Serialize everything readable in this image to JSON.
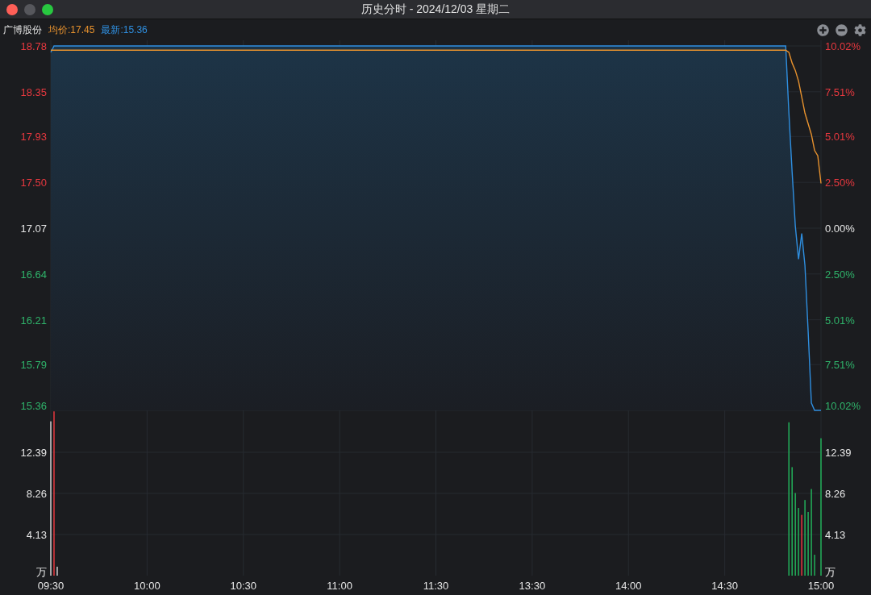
{
  "window": {
    "title": "历史分时 - 2024/12/03 星期二"
  },
  "legend": {
    "name": "广博股份",
    "average": "均价:17.45",
    "latest": "最新:15.36"
  },
  "price_axis": {
    "left": [
      {
        "color": "#e8383f"
      },
      {
        "color": "#e8383f"
      },
      {
        "color": "#e8383f"
      },
      {
        "color": "#e8383f"
      },
      {
        "color": "#e6e6e6"
      },
      {
        "color": "#2fb36a"
      },
      {
        "color": "#2fb36a"
      },
      {
        "color": "#2fb36a"
      },
      {
        "color": "#2fb36a"
      }
    ],
    "right": [
      {
        "label": "10.02%",
        "color": "#e8383f"
      },
      {
        "label": "7.51%",
        "color": "#e8383f"
      },
      {
        "label": "5.01%",
        "color": "#e8383f"
      },
      {
        "label": "2.50%",
        "color": "#e8383f"
      },
      {
        "label": "0.00%",
        "color": "#e6e6e6"
      },
      {
        "label": "2.50%",
        "color": "#2fb36a"
      },
      {
        "label": "5.01%",
        "color": "#2fb36a"
      },
      {
        "label": "7.51%",
        "color": "#2fb36a"
      },
      {
        "label": "10.02%",
        "color": "#2fb36a"
      }
    ]
  },
  "price_chart": {
    "chart_data": {
      "type": "line",
      "grid": true,
      "ylim": [
        15.36,
        18.78
      ],
      "yticks": [
        18.78,
        18.35,
        17.93,
        {
          "value": 17.5,
          "label": "17.50"
        },
        17.07,
        16.64,
        16.21,
        15.79,
        15.36
      ],
      "categories": [
        null,
        null,
        null,
        null,
        null,
        null,
        null,
        null,
        null,
        null,
        null,
        null,
        null,
        null,
        null,
        null,
        null,
        null,
        null,
        null,
        null,
        null,
        null,
        null,
        null,
        null,
        null,
        null,
        null,
        null,
        null,
        null,
        null,
        null,
        null,
        null,
        null,
        null,
        null,
        null,
        null,
        null,
        null,
        null,
        null,
        null,
        null,
        null,
        null,
        null,
        null,
        null,
        null,
        null,
        null,
        null,
        null,
        null,
        null,
        null,
        null,
        null,
        null,
        null,
        null,
        null,
        null,
        null,
        null,
        null,
        null,
        null,
        null,
        null,
        null,
        null,
        null,
        null,
        null,
        null,
        null,
        null,
        null,
        null,
        null,
        null,
        null,
        null,
        null,
        null,
        null,
        null,
        null,
        null,
        null,
        null,
        null,
        null,
        null,
        null,
        null,
        null,
        null,
        null,
        null,
        null,
        null,
        null,
        null,
        null,
        null,
        null,
        null,
        null,
        null,
        null,
        null,
        null,
        null,
        null,
        null,
        null,
        null,
        null,
        null,
        null,
        null,
        null,
        null,
        null,
        null,
        null,
        null,
        null,
        null,
        null,
        null,
        null,
        null,
        null,
        null,
        null,
        null,
        null,
        null,
        null,
        null,
        null,
        null,
        null,
        null,
        null,
        null,
        null,
        null,
        null,
        null,
        null,
        null,
        null,
        null,
        null,
        null,
        null,
        null,
        null,
        null,
        null,
        null,
        null,
        null,
        null,
        null,
        null,
        null,
        null,
        null,
        null,
        null,
        null,
        null,
        null,
        null,
        null,
        null,
        null,
        null,
        null,
        null,
        null,
        null,
        null,
        null,
        null,
        null,
        null,
        null,
        null,
        null,
        null,
        null,
        null,
        null,
        null,
        null,
        null,
        null,
        null,
        null,
        null,
        null,
        null,
        null,
        null,
        null,
        null,
        null,
        null,
        null,
        null,
        null,
        null,
        null,
        null,
        null,
        null,
        null,
        null,
        null,
        null,
        null,
        null,
        null,
        null,
        null,
        null,
        null,
        null,
        null,
        null,
        null
      ],
      "series": [
        {
          "color": "#2f8fe0",
          "values": [
            18.72,
            18.78,
            18.78,
            18.78,
            18.78,
            18.78,
            18.78,
            18.78,
            18.78,
            18.78,
            18.78,
            18.78,
            18.78,
            18.78,
            18.78,
            18.78,
            18.78,
            18.78,
            18.78,
            18.78,
            18.78,
            18.78,
            18.78,
            18.78,
            18.78,
            18.78,
            18.78,
            18.78,
            18.78,
            18.78,
            18.78,
            18.78,
            18.78,
            18.78,
            18.78,
            18.78,
            18.78,
            18.78,
            18.78,
            18.78,
            18.78,
            18.78,
            18.78,
            18.78,
            18.78,
            18.78,
            18.78,
            18.78,
            18.78,
            18.78,
            18.78,
            18.78,
            18.78,
            18.78,
            18.78,
            18.78,
            18.78,
            18.78,
            18.78,
            18.78,
            18.78,
            18.78,
            18.78,
            18.78,
            18.78,
            18.78,
            18.78,
            18.78,
            18.78,
            18.78,
            18.78,
            18.78,
            18.78,
            18.78,
            18.78,
            18.78,
            18.78,
            18.78,
            18.78,
            18.78,
            18.78,
            18.78,
            18.78,
            18.78,
            18.78,
            18.78,
            18.78,
            18.78,
            18.78,
            18.78,
            18.78,
            18.78,
            18.78,
            18.78,
            18.78,
            18.78,
            18.78,
            18.78,
            18.78,
            18.78,
            18.78,
            18.78,
            18.78,
            18.78,
            18.78,
            18.78,
            18.78,
            18.78,
            18.78,
            18.78,
            18.78,
            18.78,
            18.78,
            18.78,
            18.78,
            18.78,
            18.78,
            18.78,
            18.78,
            18.78,
            18.78,
            18.78,
            18.78,
            18.78,
            18.78,
            18.78,
            18.78,
            18.78,
            18.78,
            18.78,
            18.78,
            18.78,
            18.78,
            18.78,
            18.78,
            18.78,
            18.78,
            18.78,
            18.78,
            18.78,
            18.78,
            18.78,
            18.78,
            18.78,
            18.78,
            18.78,
            18.78,
            18.78,
            18.78,
            18.78,
            18.78,
            18.78,
            18.78,
            18.78,
            18.78,
            18.78,
            18.78,
            18.78,
            18.78,
            18.78,
            18.78,
            18.78,
            18.78,
            18.78,
            18.78,
            18.78,
            18.78,
            18.78,
            18.78,
            18.78,
            18.78,
            18.78,
            18.78,
            18.78,
            18.78,
            18.78,
            18.78,
            18.78,
            18.78,
            18.78,
            18.78,
            18.78,
            18.78,
            18.78,
            18.78,
            18.78,
            18.78,
            18.78,
            18.78,
            18.78,
            18.78,
            18.78,
            18.78,
            18.78,
            18.78,
            18.78,
            18.78,
            18.78,
            18.78,
            18.78,
            18.78,
            18.78,
            18.78,
            18.78,
            18.78,
            18.78,
            18.78,
            18.78,
            18.78,
            18.78,
            18.78,
            18.78,
            18.78,
            18.78,
            18.78,
            18.78,
            18.78,
            18.78,
            18.78,
            18.78,
            18.78,
            18.78,
            18.78,
            18.78,
            18.78,
            18.78,
            18.78,
            18.78,
            18.78,
            18.78,
            18.15,
            17.6,
            17.09,
            16.78,
            17.02,
            16.72,
            16.1,
            15.43,
            15.36,
            15.36,
            15.36
          ]
        },
        {
          "color": "#e8922e",
          "values": [
            18.74,
            18.74,
            18.74,
            18.74,
            18.74,
            18.74,
            18.74,
            18.74,
            18.74,
            18.74,
            18.74,
            18.74,
            18.74,
            18.74,
            18.74,
            18.74,
            18.74,
            18.74,
            18.74,
            18.74,
            18.74,
            18.74,
            18.74,
            18.74,
            18.74,
            18.74,
            18.74,
            18.74,
            18.74,
            18.74,
            18.74,
            18.74,
            18.74,
            18.74,
            18.74,
            18.74,
            18.74,
            18.74,
            18.74,
            18.74,
            18.74,
            18.74,
            18.74,
            18.74,
            18.74,
            18.74,
            18.74,
            18.74,
            18.74,
            18.74,
            18.74,
            18.74,
            18.74,
            18.74,
            18.74,
            18.74,
            18.74,
            18.74,
            18.74,
            18.74,
            18.74,
            18.74,
            18.74,
            18.74,
            18.74,
            18.74,
            18.74,
            18.74,
            18.74,
            18.74,
            18.74,
            18.74,
            18.74,
            18.74,
            18.74,
            18.74,
            18.74,
            18.74,
            18.74,
            18.74,
            18.74,
            18.74,
            18.74,
            18.74,
            18.74,
            18.74,
            18.74,
            18.74,
            18.74,
            18.74,
            18.74,
            18.74,
            18.74,
            18.74,
            18.74,
            18.74,
            18.74,
            18.74,
            18.74,
            18.74,
            18.74,
            18.74,
            18.74,
            18.74,
            18.74,
            18.74,
            18.74,
            18.74,
            18.74,
            18.74,
            18.74,
            18.74,
            18.74,
            18.74,
            18.74,
            18.74,
            18.74,
            18.74,
            18.74,
            18.74,
            18.74,
            18.74,
            18.74,
            18.74,
            18.74,
            18.74,
            18.74,
            18.74,
            18.74,
            18.74,
            18.74,
            18.74,
            18.74,
            18.74,
            18.74,
            18.74,
            18.74,
            18.74,
            18.74,
            18.74,
            18.74,
            18.74,
            18.74,
            18.74,
            18.74,
            18.74,
            18.74,
            18.74,
            18.74,
            18.74,
            18.74,
            18.74,
            18.74,
            18.74,
            18.74,
            18.74,
            18.74,
            18.74,
            18.74,
            18.74,
            18.74,
            18.74,
            18.74,
            18.74,
            18.74,
            18.74,
            18.74,
            18.74,
            18.74,
            18.74,
            18.74,
            18.74,
            18.74,
            18.74,
            18.74,
            18.74,
            18.74,
            18.74,
            18.74,
            18.74,
            18.74,
            18.74,
            18.74,
            18.74,
            18.74,
            18.74,
            18.74,
            18.74,
            18.74,
            18.74,
            18.74,
            18.74,
            18.74,
            18.74,
            18.74,
            18.74,
            18.74,
            18.74,
            18.74,
            18.74,
            18.74,
            18.74,
            18.74,
            18.74,
            18.74,
            18.74,
            18.74,
            18.74,
            18.74,
            18.74,
            18.74,
            18.74,
            18.74,
            18.74,
            18.74,
            18.74,
            18.74,
            18.74,
            18.74,
            18.74,
            18.74,
            18.74,
            18.74,
            18.74,
            18.74,
            18.74,
            18.74,
            18.74,
            18.74,
            18.74,
            18.72,
            18.62,
            18.55,
            18.45,
            18.3,
            18.15,
            18.05,
            17.95,
            17.8,
            17.75,
            17.49
          ]
        }
      ]
    }
  },
  "volume_chart": {
    "chart_data": {
      "type": "bar",
      "grid": true,
      "ylim": [
        0,
        16.52
      ],
      "categories": [
        "09:30",
        null,
        null,
        null,
        null,
        null,
        null,
        null,
        null,
        null,
        null,
        null,
        null,
        null,
        null,
        null,
        null,
        null,
        null,
        null,
        null,
        null,
        null,
        null,
        null,
        null,
        null,
        null,
        null,
        null,
        "10:00",
        null,
        null,
        null,
        null,
        null,
        null,
        null,
        null,
        null,
        null,
        null,
        null,
        null,
        null,
        null,
        null,
        null,
        null,
        null,
        null,
        null,
        null,
        null,
        null,
        null,
        null,
        null,
        null,
        null,
        "10:30",
        null,
        null,
        null,
        null,
        null,
        null,
        null,
        null,
        null,
        null,
        null,
        null,
        null,
        null,
        null,
        null,
        null,
        null,
        null,
        null,
        null,
        null,
        null,
        null,
        null,
        null,
        null,
        null,
        null,
        "11:00",
        null,
        null,
        null,
        null,
        null,
        null,
        null,
        null,
        null,
        null,
        null,
        null,
        null,
        null,
        null,
        null,
        null,
        null,
        null,
        null,
        null,
        null,
        null,
        null,
        null,
        null,
        null,
        null,
        null,
        "11:30",
        null,
        null,
        null,
        null,
        null,
        null,
        null,
        null,
        null,
        null,
        null,
        null,
        null,
        null,
        null,
        null,
        null,
        null,
        null,
        null,
        null,
        null,
        null,
        null,
        null,
        null,
        null,
        null,
        null,
        "13:30",
        null,
        null,
        null,
        null,
        null,
        null,
        null,
        null,
        null,
        null,
        null,
        null,
        null,
        null,
        null,
        null,
        null,
        null,
        null,
        null,
        null,
        null,
        null,
        null,
        null,
        null,
        null,
        null,
        null,
        "14:00",
        null,
        null,
        null,
        null,
        null,
        null,
        null,
        null,
        null,
        null,
        null,
        null,
        null,
        null,
        null,
        null,
        null,
        null,
        null,
        null,
        null,
        null,
        null,
        null,
        null,
        null,
        null,
        null,
        null,
        "14:30",
        null,
        null,
        null,
        null,
        null,
        null,
        null,
        null,
        null,
        null,
        null,
        null,
        null,
        null,
        null,
        null,
        null,
        null,
        null,
        null,
        null,
        null,
        null,
        null,
        null,
        null,
        null,
        null,
        null,
        "15:00"
      ],
      "yticks": [
        {
          "value": 0,
          "label": "万"
        },
        {
          "value": 4.13,
          "label": "4.13"
        },
        {
          "value": 8.26,
          "label": "8.26"
        },
        {
          "value": 12.39,
          "label": "12.39"
        }
      ],
      "series": [
        {
          "color": "#d0d0d0",
          "values": [
            15.5,
            null,
            0.9,
            null,
            null,
            null,
            null,
            null,
            null,
            null,
            null,
            null,
            null,
            null,
            null,
            null,
            null,
            null,
            null,
            null,
            null,
            null,
            null,
            null,
            null,
            null,
            null,
            null,
            null,
            null,
            null,
            null,
            null,
            null,
            null,
            null,
            null,
            null,
            null,
            null,
            null,
            null,
            null,
            null,
            null,
            null,
            null,
            null,
            null,
            null,
            null,
            null,
            null,
            null,
            null,
            null,
            null,
            null,
            null,
            null,
            null,
            null,
            null,
            null,
            null,
            null,
            null,
            null,
            null,
            null,
            null,
            null,
            null,
            null,
            null,
            null,
            null,
            null,
            null,
            null,
            null,
            null,
            null,
            null,
            null,
            null,
            null,
            null,
            null,
            null,
            null,
            null,
            null,
            null,
            null,
            null,
            null,
            null,
            null,
            null,
            null,
            null,
            null,
            null,
            null,
            null,
            null,
            null,
            null,
            null,
            null,
            null,
            null,
            null,
            null,
            null,
            null,
            null,
            null,
            null,
            null,
            null,
            null,
            null,
            null,
            null,
            null,
            null,
            null,
            null,
            null,
            null,
            null,
            null,
            null,
            null,
            null,
            null,
            null,
            null,
            null,
            null,
            null,
            null,
            null,
            null,
            null,
            null,
            null,
            null,
            null,
            null,
            null,
            null,
            null,
            null,
            null,
            null,
            null,
            null,
            null,
            null,
            null,
            null,
            null,
            null,
            null,
            null,
            null,
            null,
            null,
            null,
            null,
            null,
            null,
            null,
            null,
            null,
            null,
            null,
            null,
            null,
            null,
            null,
            null,
            null,
            null,
            null,
            null,
            null,
            null,
            null,
            null,
            null,
            null,
            null,
            null,
            null,
            null,
            null,
            null,
            null,
            null,
            null,
            null,
            null,
            null,
            null,
            null,
            null,
            null,
            null,
            null,
            null,
            null,
            null,
            null,
            null,
            null,
            null,
            null,
            null,
            null,
            null,
            null,
            null,
            null,
            null,
            null,
            null,
            null,
            null,
            null,
            null,
            null,
            null,
            null,
            null,
            null,
            null,
            null
          ]
        },
        {
          "color": "#e8383f",
          "values": [
            null,
            16.5,
            null,
            null,
            null,
            null,
            null,
            null,
            null,
            null,
            null,
            null,
            null,
            null,
            null,
            null,
            null,
            null,
            null,
            null,
            null,
            null,
            null,
            null,
            null,
            null,
            null,
            null,
            null,
            null,
            null,
            null,
            null,
            null,
            null,
            null,
            null,
            null,
            null,
            null,
            null,
            null,
            null,
            null,
            null,
            null,
            null,
            null,
            null,
            null,
            null,
            null,
            null,
            null,
            null,
            null,
            null,
            null,
            null,
            null,
            null,
            null,
            null,
            null,
            null,
            null,
            null,
            null,
            null,
            null,
            null,
            null,
            null,
            null,
            null,
            null,
            null,
            null,
            null,
            null,
            null,
            null,
            null,
            null,
            null,
            null,
            null,
            null,
            null,
            null,
            null,
            null,
            null,
            null,
            null,
            null,
            null,
            null,
            null,
            null,
            null,
            null,
            null,
            null,
            null,
            null,
            null,
            null,
            null,
            null,
            null,
            null,
            null,
            null,
            null,
            null,
            null,
            null,
            null,
            null,
            null,
            null,
            null,
            null,
            null,
            null,
            null,
            null,
            null,
            null,
            null,
            null,
            null,
            null,
            null,
            null,
            null,
            null,
            null,
            null,
            null,
            null,
            null,
            null,
            null,
            null,
            null,
            null,
            null,
            null,
            null,
            null,
            null,
            null,
            null,
            null,
            null,
            null,
            null,
            null,
            null,
            null,
            null,
            null,
            null,
            null,
            null,
            null,
            null,
            null,
            null,
            null,
            null,
            null,
            null,
            null,
            null,
            null,
            null,
            null,
            null,
            null,
            null,
            null,
            null,
            null,
            null,
            null,
            null,
            null,
            null,
            null,
            null,
            null,
            null,
            null,
            null,
            null,
            null,
            null,
            null,
            null,
            null,
            null,
            null,
            null,
            null,
            null,
            null,
            null,
            null,
            null,
            null,
            null,
            null,
            null,
            null,
            null,
            null,
            null,
            null,
            null,
            null,
            null,
            null,
            null,
            null,
            null,
            null,
            null,
            null,
            null,
            null,
            null,
            6.1,
            null,
            null,
            null,
            null,
            null,
            null
          ]
        },
        {
          "color": "#22b05a",
          "values": [
            null,
            null,
            null,
            null,
            null,
            null,
            null,
            null,
            null,
            null,
            null,
            null,
            null,
            null,
            null,
            null,
            null,
            null,
            null,
            null,
            null,
            null,
            null,
            null,
            null,
            null,
            null,
            null,
            null,
            null,
            null,
            null,
            null,
            null,
            null,
            null,
            null,
            null,
            null,
            null,
            null,
            null,
            null,
            null,
            null,
            null,
            null,
            null,
            null,
            null,
            null,
            null,
            null,
            null,
            null,
            null,
            null,
            null,
            null,
            null,
            null,
            null,
            null,
            null,
            null,
            null,
            null,
            null,
            null,
            null,
            null,
            null,
            null,
            null,
            null,
            null,
            null,
            null,
            null,
            null,
            null,
            null,
            null,
            null,
            null,
            null,
            null,
            null,
            null,
            null,
            null,
            null,
            null,
            null,
            null,
            null,
            null,
            null,
            null,
            null,
            null,
            null,
            null,
            null,
            null,
            null,
            null,
            null,
            null,
            null,
            null,
            null,
            null,
            null,
            null,
            null,
            null,
            null,
            null,
            null,
            null,
            null,
            null,
            null,
            null,
            null,
            null,
            null,
            null,
            null,
            null,
            null,
            null,
            null,
            null,
            null,
            null,
            null,
            null,
            null,
            null,
            null,
            null,
            null,
            null,
            null,
            null,
            null,
            null,
            null,
            null,
            null,
            null,
            null,
            null,
            null,
            null,
            null,
            null,
            null,
            null,
            null,
            null,
            null,
            null,
            null,
            null,
            null,
            null,
            null,
            null,
            null,
            null,
            null,
            null,
            null,
            null,
            null,
            null,
            null,
            null,
            null,
            null,
            null,
            null,
            null,
            null,
            null,
            null,
            null,
            null,
            null,
            null,
            null,
            null,
            null,
            null,
            null,
            null,
            null,
            null,
            null,
            null,
            null,
            null,
            null,
            null,
            null,
            null,
            null,
            null,
            null,
            null,
            null,
            null,
            null,
            null,
            null,
            null,
            null,
            null,
            null,
            null,
            null,
            null,
            null,
            null,
            null,
            null,
            null,
            15.4,
            10.9,
            8.3,
            6.8,
            null,
            7.6,
            6.4,
            8.7,
            2.1,
            null,
            13.8
          ]
        }
      ]
    }
  }
}
